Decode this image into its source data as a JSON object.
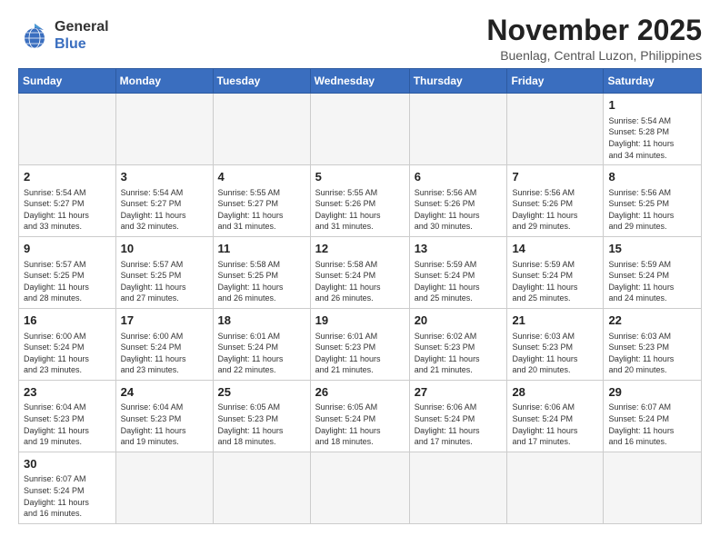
{
  "logo": {
    "line1": "General",
    "line2": "Blue"
  },
  "title": "November 2025",
  "subtitle": "Buenlag, Central Luzon, Philippines",
  "weekdays": [
    "Sunday",
    "Monday",
    "Tuesday",
    "Wednesday",
    "Thursday",
    "Friday",
    "Saturday"
  ],
  "weeks": [
    [
      {
        "day": "",
        "info": ""
      },
      {
        "day": "",
        "info": ""
      },
      {
        "day": "",
        "info": ""
      },
      {
        "day": "",
        "info": ""
      },
      {
        "day": "",
        "info": ""
      },
      {
        "day": "",
        "info": ""
      },
      {
        "day": "1",
        "info": "Sunrise: 5:54 AM\nSunset: 5:28 PM\nDaylight: 11 hours\nand 34 minutes."
      }
    ],
    [
      {
        "day": "2",
        "info": "Sunrise: 5:54 AM\nSunset: 5:27 PM\nDaylight: 11 hours\nand 33 minutes."
      },
      {
        "day": "3",
        "info": "Sunrise: 5:54 AM\nSunset: 5:27 PM\nDaylight: 11 hours\nand 32 minutes."
      },
      {
        "day": "4",
        "info": "Sunrise: 5:55 AM\nSunset: 5:27 PM\nDaylight: 11 hours\nand 31 minutes."
      },
      {
        "day": "5",
        "info": "Sunrise: 5:55 AM\nSunset: 5:26 PM\nDaylight: 11 hours\nand 31 minutes."
      },
      {
        "day": "6",
        "info": "Sunrise: 5:56 AM\nSunset: 5:26 PM\nDaylight: 11 hours\nand 30 minutes."
      },
      {
        "day": "7",
        "info": "Sunrise: 5:56 AM\nSunset: 5:26 PM\nDaylight: 11 hours\nand 29 minutes."
      },
      {
        "day": "8",
        "info": "Sunrise: 5:56 AM\nSunset: 5:25 PM\nDaylight: 11 hours\nand 29 minutes."
      }
    ],
    [
      {
        "day": "9",
        "info": "Sunrise: 5:57 AM\nSunset: 5:25 PM\nDaylight: 11 hours\nand 28 minutes."
      },
      {
        "day": "10",
        "info": "Sunrise: 5:57 AM\nSunset: 5:25 PM\nDaylight: 11 hours\nand 27 minutes."
      },
      {
        "day": "11",
        "info": "Sunrise: 5:58 AM\nSunset: 5:25 PM\nDaylight: 11 hours\nand 26 minutes."
      },
      {
        "day": "12",
        "info": "Sunrise: 5:58 AM\nSunset: 5:24 PM\nDaylight: 11 hours\nand 26 minutes."
      },
      {
        "day": "13",
        "info": "Sunrise: 5:59 AM\nSunset: 5:24 PM\nDaylight: 11 hours\nand 25 minutes."
      },
      {
        "day": "14",
        "info": "Sunrise: 5:59 AM\nSunset: 5:24 PM\nDaylight: 11 hours\nand 25 minutes."
      },
      {
        "day": "15",
        "info": "Sunrise: 5:59 AM\nSunset: 5:24 PM\nDaylight: 11 hours\nand 24 minutes."
      }
    ],
    [
      {
        "day": "16",
        "info": "Sunrise: 6:00 AM\nSunset: 5:24 PM\nDaylight: 11 hours\nand 23 minutes."
      },
      {
        "day": "17",
        "info": "Sunrise: 6:00 AM\nSunset: 5:24 PM\nDaylight: 11 hours\nand 23 minutes."
      },
      {
        "day": "18",
        "info": "Sunrise: 6:01 AM\nSunset: 5:24 PM\nDaylight: 11 hours\nand 22 minutes."
      },
      {
        "day": "19",
        "info": "Sunrise: 6:01 AM\nSunset: 5:23 PM\nDaylight: 11 hours\nand 21 minutes."
      },
      {
        "day": "20",
        "info": "Sunrise: 6:02 AM\nSunset: 5:23 PM\nDaylight: 11 hours\nand 21 minutes."
      },
      {
        "day": "21",
        "info": "Sunrise: 6:03 AM\nSunset: 5:23 PM\nDaylight: 11 hours\nand 20 minutes."
      },
      {
        "day": "22",
        "info": "Sunrise: 6:03 AM\nSunset: 5:23 PM\nDaylight: 11 hours\nand 20 minutes."
      }
    ],
    [
      {
        "day": "23",
        "info": "Sunrise: 6:04 AM\nSunset: 5:23 PM\nDaylight: 11 hours\nand 19 minutes."
      },
      {
        "day": "24",
        "info": "Sunrise: 6:04 AM\nSunset: 5:23 PM\nDaylight: 11 hours\nand 19 minutes."
      },
      {
        "day": "25",
        "info": "Sunrise: 6:05 AM\nSunset: 5:23 PM\nDaylight: 11 hours\nand 18 minutes."
      },
      {
        "day": "26",
        "info": "Sunrise: 6:05 AM\nSunset: 5:24 PM\nDaylight: 11 hours\nand 18 minutes."
      },
      {
        "day": "27",
        "info": "Sunrise: 6:06 AM\nSunset: 5:24 PM\nDaylight: 11 hours\nand 17 minutes."
      },
      {
        "day": "28",
        "info": "Sunrise: 6:06 AM\nSunset: 5:24 PM\nDaylight: 11 hours\nand 17 minutes."
      },
      {
        "day": "29",
        "info": "Sunrise: 6:07 AM\nSunset: 5:24 PM\nDaylight: 11 hours\nand 16 minutes."
      }
    ],
    [
      {
        "day": "30",
        "info": "Sunrise: 6:07 AM\nSunset: 5:24 PM\nDaylight: 11 hours\nand 16 minutes."
      },
      {
        "day": "",
        "info": ""
      },
      {
        "day": "",
        "info": ""
      },
      {
        "day": "",
        "info": ""
      },
      {
        "day": "",
        "info": ""
      },
      {
        "day": "",
        "info": ""
      },
      {
        "day": "",
        "info": ""
      }
    ]
  ]
}
